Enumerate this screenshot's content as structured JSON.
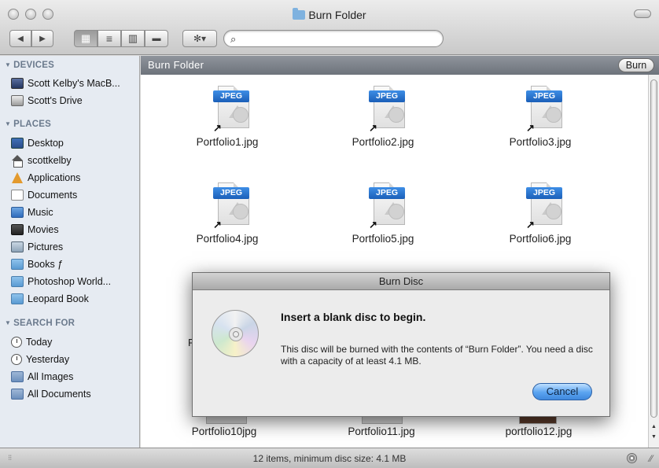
{
  "window": {
    "title": "Burn Folder"
  },
  "toolbar": {
    "back": "◀",
    "forward": "▶",
    "view_icon": "▦",
    "view_list": "≡",
    "view_column": "▥",
    "view_coverflow": "▬",
    "action": "✻▾",
    "search_placeholder": "",
    "search_icon": "🔍"
  },
  "sidebar": {
    "sections": [
      {
        "title": "DEVICES",
        "items": [
          {
            "label": "Scott Kelby's MacB...",
            "icon": "laptop-icon"
          },
          {
            "label": "Scott's Drive",
            "icon": "drive-icon"
          }
        ]
      },
      {
        "title": "PLACES",
        "items": [
          {
            "label": "Desktop",
            "icon": "desktop-icon"
          },
          {
            "label": "scottkelby",
            "icon": "home-icon"
          },
          {
            "label": "Applications",
            "icon": "applications-icon"
          },
          {
            "label": "Documents",
            "icon": "documents-icon"
          },
          {
            "label": "Music",
            "icon": "music-icon"
          },
          {
            "label": "Movies",
            "icon": "movies-icon"
          },
          {
            "label": "Pictures",
            "icon": "pictures-icon"
          },
          {
            "label": "Books ƒ",
            "icon": "folder-icon"
          },
          {
            "label": "Photoshop World...",
            "icon": "folder-icon"
          },
          {
            "label": "Leopard Book",
            "icon": "folder-icon"
          }
        ]
      },
      {
        "title": "SEARCH FOR",
        "items": [
          {
            "label": "Today",
            "icon": "clock-icon"
          },
          {
            "label": "Yesterday",
            "icon": "clock-icon"
          },
          {
            "label": "All Images",
            "icon": "smart-folder-icon"
          },
          {
            "label": "All Documents",
            "icon": "smart-folder-icon"
          }
        ]
      }
    ]
  },
  "pathbar": {
    "title": "Burn Folder",
    "burn_button": "Burn"
  },
  "files": [
    {
      "name": "Portfolio1.jpg",
      "badge": "JPEG"
    },
    {
      "name": "Portfolio2.jpg",
      "badge": "JPEG"
    },
    {
      "name": "Portfolio3.jpg",
      "badge": "JPEG"
    },
    {
      "name": "Portfolio4.jpg",
      "badge": "JPEG"
    },
    {
      "name": "Portfolio5.jpg",
      "badge": "JPEG"
    },
    {
      "name": "Portfolio6.jpg",
      "badge": "JPEG"
    },
    {
      "name": "Portfolio10jpg",
      "badge": ""
    },
    {
      "name": "Portfolio11.jpg",
      "badge": ""
    },
    {
      "name": "portfolio12.jpg",
      "badge": ""
    }
  ],
  "partial_text": "P",
  "alias_arrow": "↗",
  "dialog": {
    "title": "Burn Disc",
    "heading": "Insert a blank disc to begin.",
    "body": "This disc will be burned with the contents of “Burn Folder”. You need a disc with a capacity of at least 4.1 MB.",
    "cancel": "Cancel"
  },
  "status": {
    "text": "12 items, minimum disc size: 4.1 MB"
  },
  "colors": {
    "pathbar": "#7f858d",
    "sidebar": "#e6ebf2",
    "default_button": "#5aa3f0",
    "jpeg_badge": "#2a74cf"
  }
}
